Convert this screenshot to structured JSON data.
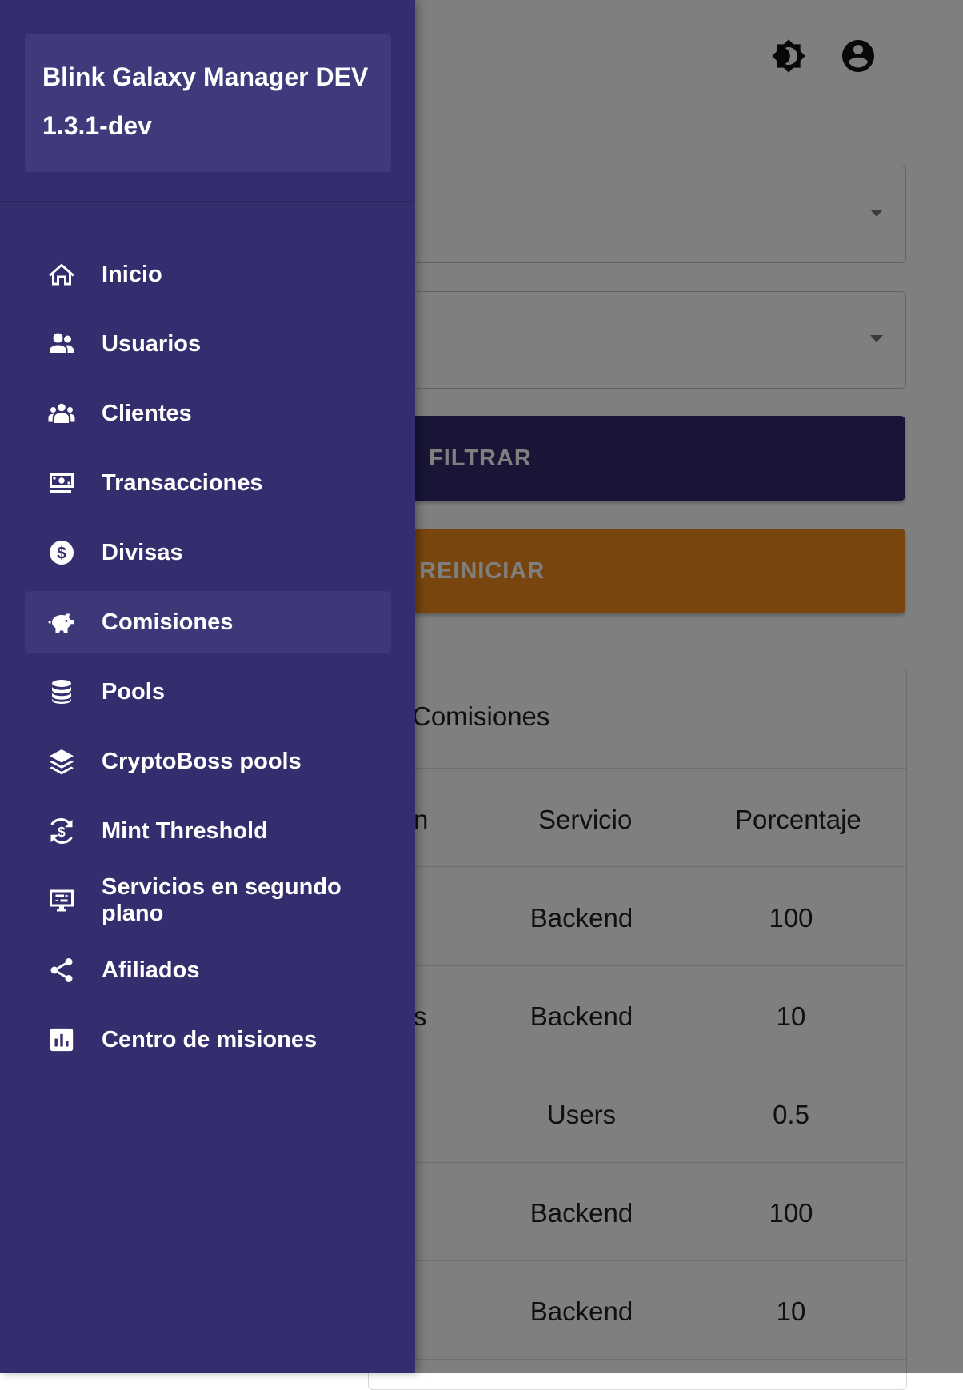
{
  "app": {
    "name": "Blink Galaxy Manager DEV",
    "version": "1.3.1-dev"
  },
  "sidebar": {
    "items": [
      {
        "label": "Inicio",
        "icon": "home-icon",
        "active": false
      },
      {
        "label": "Usuarios",
        "icon": "users-icon",
        "active": false
      },
      {
        "label": "Clientes",
        "icon": "clients-icon",
        "active": false
      },
      {
        "label": "Transacciones",
        "icon": "money-icon",
        "active": false
      },
      {
        "label": "Divisas",
        "icon": "dollar-coin-icon",
        "active": false
      },
      {
        "label": "Comisiones",
        "icon": "piggy-bank-icon",
        "active": true
      },
      {
        "label": "Pools",
        "icon": "database-icon",
        "active": false
      },
      {
        "label": "CryptoBoss pools",
        "icon": "layers-icon",
        "active": false
      },
      {
        "label": "Mint Threshold",
        "icon": "currency-exchange-icon",
        "active": false
      },
      {
        "label": "Servicios en segundo plano",
        "icon": "background-services-icon",
        "active": false
      },
      {
        "label": "Afiliados",
        "icon": "share-icon",
        "active": false
      },
      {
        "label": "Centro de misiones",
        "icon": "chart-icon",
        "active": false
      }
    ]
  },
  "toolbar": {
    "theme_icon": "brightness-icon",
    "account_icon": "account-circle-icon"
  },
  "filters": {
    "filter_label": "FILTRAR",
    "reset_label": "REINICIAR"
  },
  "table": {
    "title": "Comisiones",
    "partial_header": "n",
    "headers": [
      "Servicio",
      "Porcentaje"
    ],
    "rows": [
      {
        "edge": "",
        "servicio": "Backend",
        "porcentaje": "100"
      },
      {
        "edge": "s",
        "servicio": "Backend",
        "porcentaje": "10"
      },
      {
        "edge": "",
        "servicio": "Users",
        "porcentaje": "0.5"
      },
      {
        "edge": "",
        "servicio": "Backend",
        "porcentaje": "100"
      },
      {
        "edge": "",
        "servicio": "Backend",
        "porcentaje": "10"
      }
    ]
  },
  "colors": {
    "drawer": "#342e6e",
    "filter_button": "#302a6e",
    "reset_button": "#f08a1c"
  }
}
